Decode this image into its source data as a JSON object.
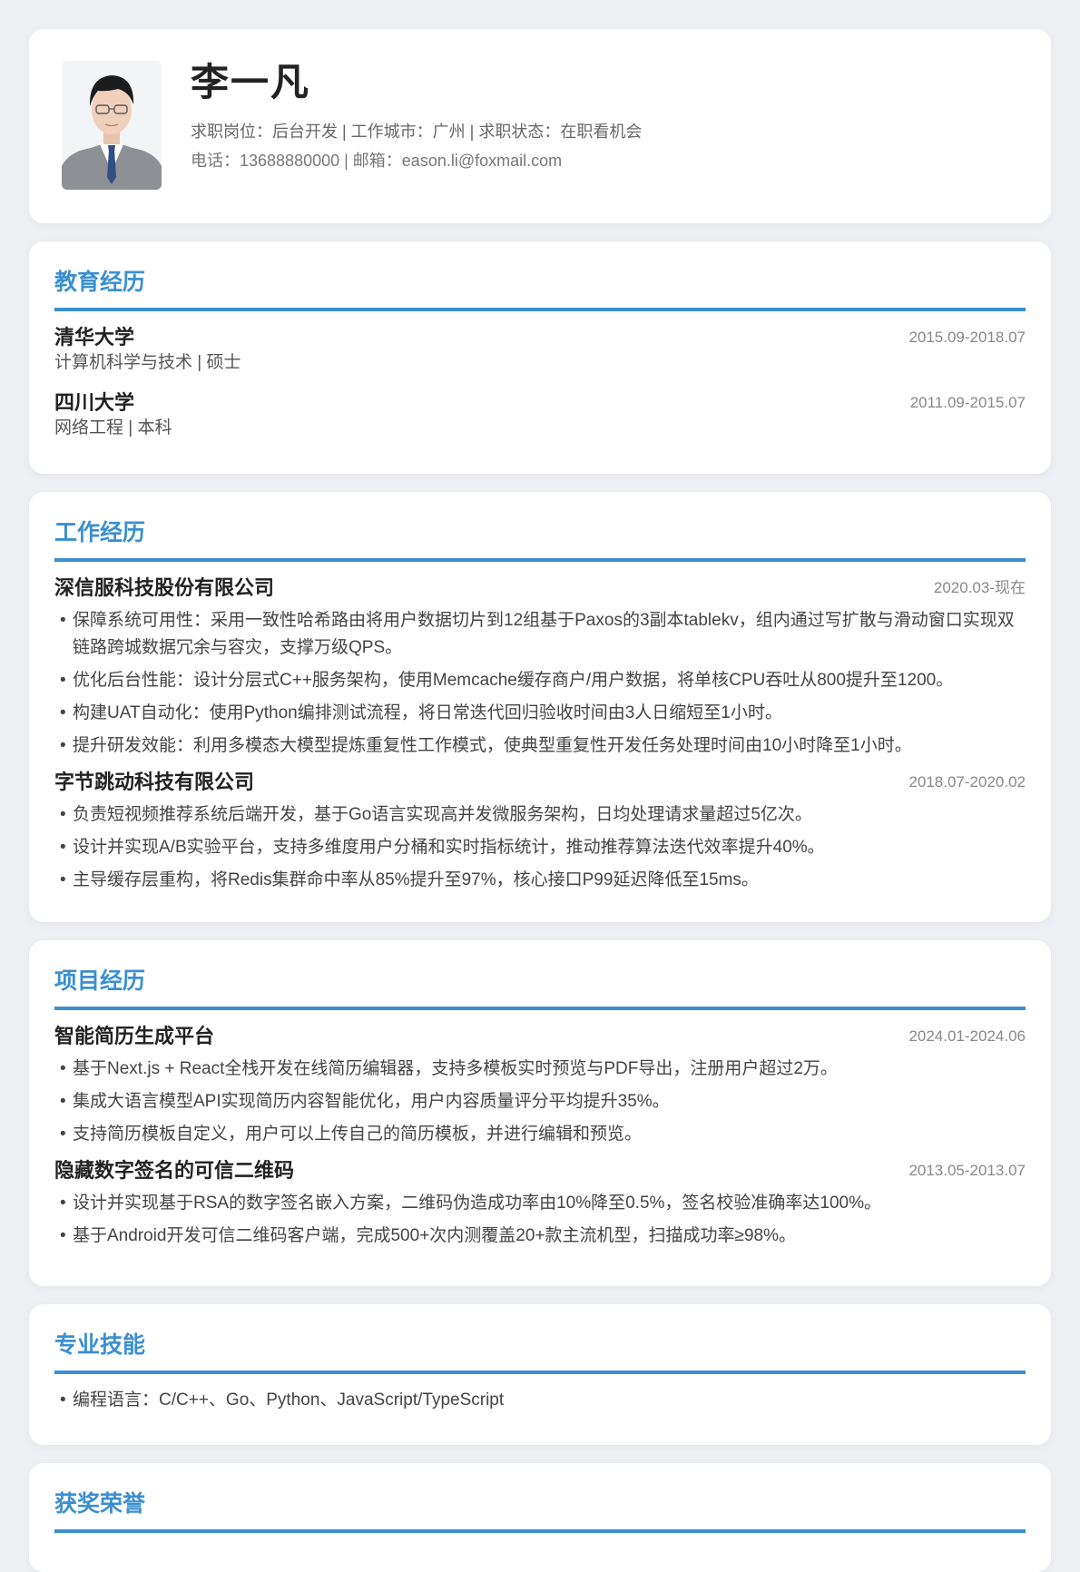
{
  "header": {
    "name": "李一凡",
    "job_line": "求职岗位：后台开发 | 工作城市：广州 | 求职状态：在职看机会",
    "contact_line": "电话：13688880000 | 邮箱：eason.li@foxmail.com",
    "accent": "#3b8fd0"
  },
  "education": {
    "title": "教育经历",
    "items": [
      {
        "school": "清华大学",
        "detail": "计算机科学与技术 | 硕士",
        "date": "2015.09-2018.07"
      },
      {
        "school": "四川大学",
        "detail": "网络工程 | 本科",
        "date": "2011.09-2015.07"
      }
    ]
  },
  "work": {
    "title": "工作经历",
    "items": [
      {
        "company": "深信服科技股份有限公司",
        "date": "2020.03-现在",
        "bullets": [
          "保障系统可用性：采用一致性哈希路由将用户数据切片到12组基于Paxos的3副本tablekv，组内通过写扩散与滑动窗口实现双链路跨城数据冗余与容灾，支撑万级QPS。",
          "优化后台性能：设计分层式C++服务架构，使用Memcache缓存商户/用户数据，将单核CPU吞吐从800提升至1200。",
          "构建UAT自动化：使用Python编排测试流程，将日常迭代回归验收时间由3人日缩短至1小时。",
          "提升研发效能：利用多模态大模型提炼重复性工作模式，使典型重复性开发任务处理时间由10小时降至1小时。"
        ]
      },
      {
        "company": "字节跳动科技有限公司",
        "date": "2018.07-2020.02",
        "bullets": [
          "负责短视频推荐系统后端开发，基于Go语言实现高并发微服务架构，日均处理请求量超过5亿次。",
          "设计并实现A/B实验平台，支持多维度用户分桶和实时指标统计，推动推荐算法迭代效率提升40%。",
          "主导缓存层重构，将Redis集群命中率从85%提升至97%，核心接口P99延迟降低至15ms。"
        ]
      }
    ]
  },
  "projects": {
    "title": "项目经历",
    "items": [
      {
        "name": "智能简历生成平台",
        "date": "2024.01-2024.06",
        "bullets": [
          "基于Next.js + React全栈开发在线简历编辑器，支持多模板实时预览与PDF导出，注册用户超过2万。",
          "集成大语言模型API实现简历内容智能优化，用户内容质量评分平均提升35%。",
          "支持简历模板自定义，用户可以上传自己的简历模板，并进行编辑和预览。"
        ]
      },
      {
        "name": "隐藏数字签名的可信二维码",
        "date": "2013.05-2013.07",
        "bullets": [
          "设计并实现基于RSA的数字签名嵌入方案，二维码伪造成功率由10%降至0.5%，签名校验准确率达100%。",
          "基于Android开发可信二维码客户端，完成500+次内测覆盖20+款主流机型，扫描成功率≥98%。"
        ]
      }
    ]
  },
  "skills": {
    "title": "专业技能",
    "bullets": [
      "编程语言：C/C++、Go、Python、JavaScript/TypeScript"
    ]
  },
  "awards": {
    "title": "获奖荣誉"
  }
}
